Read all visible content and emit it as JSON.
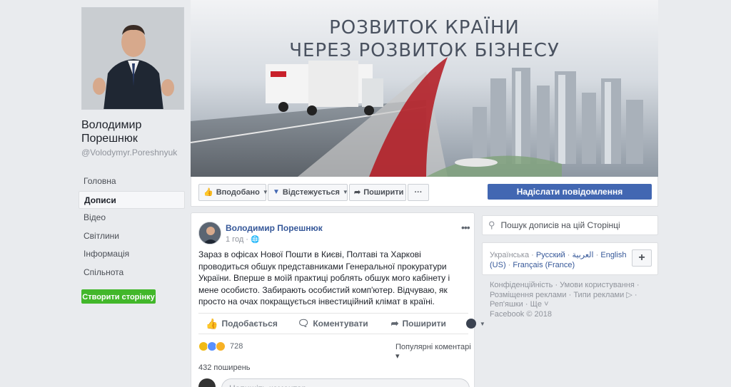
{
  "page": {
    "name": "Володимир Порешнюк",
    "name_line1": "Володимир",
    "name_line2": "Порешнюк",
    "username": "@Volodymyr.Poreshnyuk"
  },
  "nav": {
    "items": [
      "Головна",
      "Дописи",
      "Відео",
      "Світлини",
      "Інформація",
      "Спільнота"
    ],
    "active": "Дописи"
  },
  "create_page_button": "Створити сторінку",
  "cover": {
    "line1": "РОЗВИТОК КРАЇНИ",
    "line2": "ЧЕРЕЗ РОЗВИТОК БІЗНЕСУ"
  },
  "actions": {
    "liked": "Вподобано",
    "following": "Відстежується",
    "share": "Поширити",
    "more": "···",
    "send_message": "Надіслати повідомлення"
  },
  "post": {
    "author": "Володимир Порешнюк",
    "time": "1 год ·",
    "text": "Зараз в офісах Нової Пошти в Києві, Полтаві та Харкові проводиться обшук представниками Генеральної прокуратури України. Вперше в моїй практиці роблять обшук мого кабінету і мене особисто. Забирають особистий комп'ютер. Відчуваю, як просто на очах покращується інвестиційний клімат в країні.",
    "like_label": "Подобається",
    "comment_label": "Коментувати",
    "share_label": "Поширити",
    "reactions_count": "728",
    "popular_comments": "Популярні коментарі ▾",
    "shares": "432 поширень",
    "comment_placeholder": "Напишіть коментар..."
  },
  "search": {
    "placeholder": "Пошук дописів на цій Сторінці"
  },
  "languages": {
    "current": "Українська",
    "others": [
      "Русский",
      "العربية",
      "English (US)",
      "Français (France)"
    ]
  },
  "footer": {
    "links": [
      "Конфіденційність",
      "Умови користування",
      "Розміщення реклами",
      "Типи реклами",
      "Реп'яшки",
      "Ще"
    ],
    "copyright": "Facebook © 2018"
  },
  "colors": {
    "brand": "#4267b2",
    "green": "#42b72a",
    "link": "#365899"
  }
}
